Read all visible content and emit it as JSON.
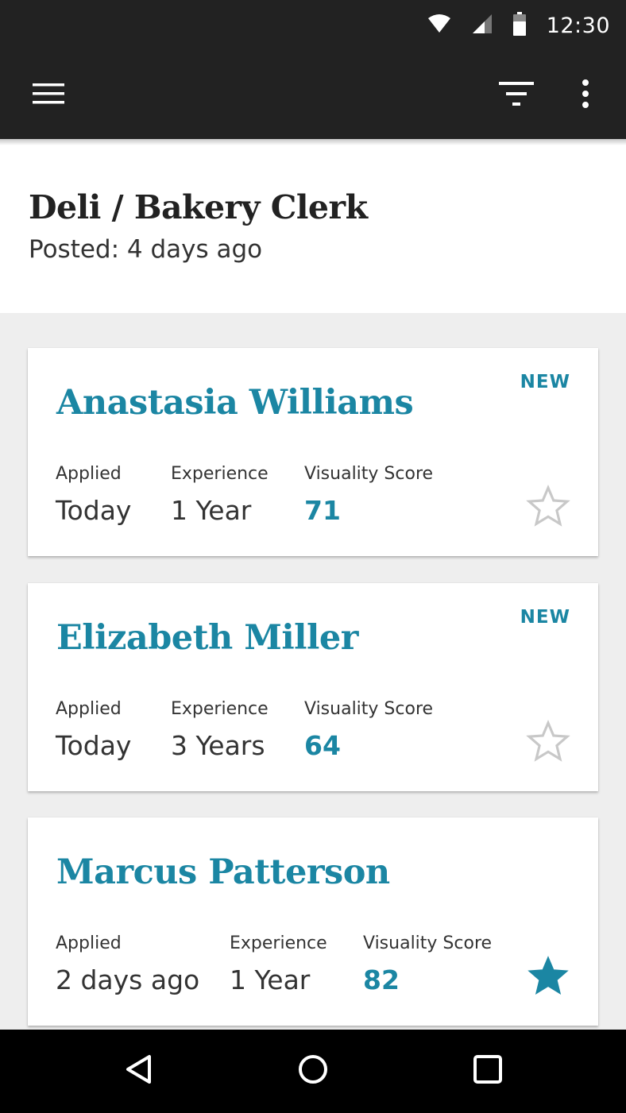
{
  "status_bar": {
    "time": "12:30",
    "icons": [
      "wifi-icon",
      "cell-signal-icon",
      "battery-icon"
    ]
  },
  "app_bar": {
    "icons": [
      "menu-icon",
      "filter-icon",
      "more-vert-icon"
    ]
  },
  "job": {
    "title": "Deli / Bakery Clerk",
    "posted": "Posted: 4 days ago"
  },
  "candidates": [
    {
      "name": "Anastasia Williams",
      "badge": "NEW",
      "applied_label": "Applied",
      "applied": "Today",
      "experience_label": "Experience",
      "experience": "1 Year",
      "score_label": "Visuality Score",
      "score": "71",
      "starred": false
    },
    {
      "name": "Elizabeth Miller",
      "badge": "NEW",
      "applied_label": "Applied",
      "applied": "Today",
      "experience_label": "Experience",
      "experience": "3 Years",
      "score_label": "Visuality Score",
      "score": "64",
      "starred": false
    },
    {
      "name": "Marcus Patterson",
      "badge": "",
      "applied_label": "Applied",
      "applied": "2 days ago",
      "experience_label": "Experience",
      "experience": "1 Year",
      "score_label": "Visuality Score",
      "score": "82",
      "starred": true
    }
  ],
  "nav_bar": {
    "icons": [
      "back-icon",
      "home-icon",
      "recents-icon"
    ]
  },
  "colors": {
    "accent": "#1b86a3",
    "app_bar": "#222222",
    "background": "#eeeeee",
    "star_outline": "#c8c8c8"
  }
}
